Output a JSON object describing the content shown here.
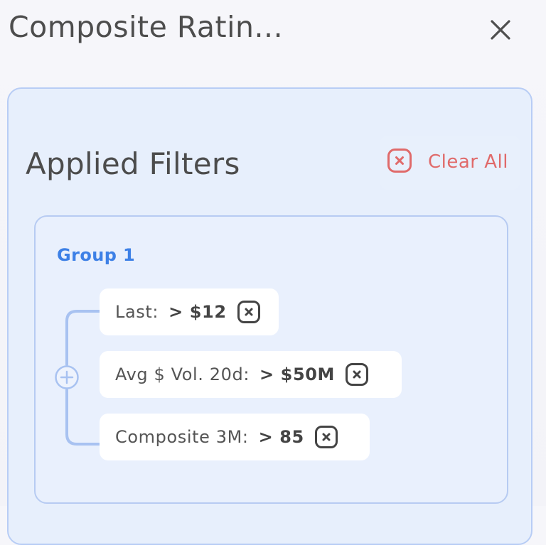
{
  "header": {
    "title": "Composite Ratin...",
    "close_icon": "close-icon"
  },
  "filters_panel": {
    "heading": "Applied Filters",
    "clear_all_label": "Clear All",
    "clear_all_icon": "close-square-icon",
    "accent_color": "#e06a6a"
  },
  "group": {
    "title": "Group 1",
    "title_color": "#3d80e6",
    "add_icon": "plus-circle-icon",
    "filters": [
      {
        "name": "Last:",
        "value": "> $12",
        "remove_icon": "close-square-icon"
      },
      {
        "name": "Avg $ Vol. 20d:",
        "value": "> $50M",
        "remove_icon": "close-square-icon"
      },
      {
        "name": "Composite 3M:",
        "value": "> 85",
        "remove_icon": "close-square-icon"
      }
    ]
  }
}
